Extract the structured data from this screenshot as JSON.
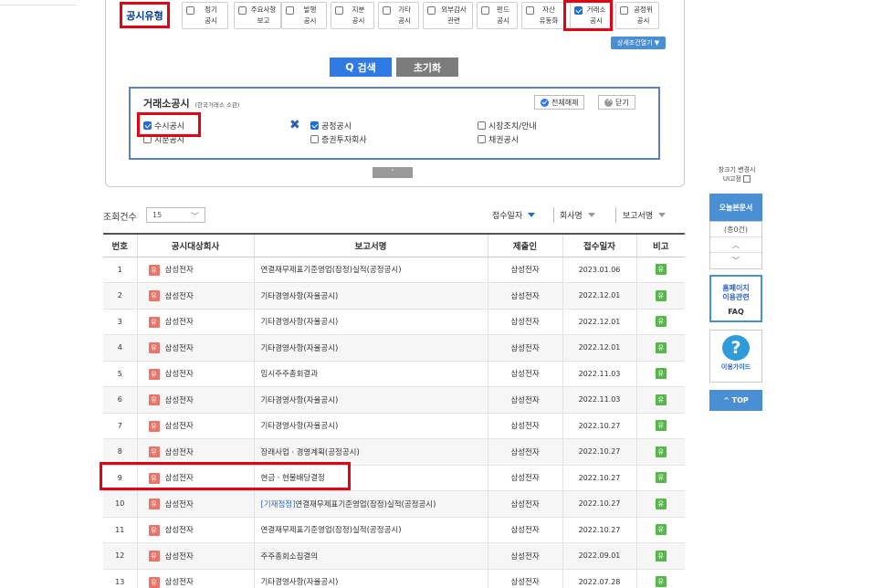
{
  "filter": {
    "type_label": "공시유형",
    "types": [
      {
        "l1": "정기",
        "l2": "공시",
        "checked": false
      },
      {
        "l1": "주요사항",
        "l2": "보고",
        "checked": false
      },
      {
        "l1": "발행",
        "l2": "공시",
        "checked": false
      },
      {
        "l1": "지분",
        "l2": "공시",
        "checked": false
      },
      {
        "l1": "기타",
        "l2": "공시",
        "checked": false
      },
      {
        "l1": "외부감사",
        "l2": "관련",
        "checked": false
      },
      {
        "l1": "펀드",
        "l2": "공시",
        "checked": false
      },
      {
        "l1": "자산",
        "l2": "유동화",
        "checked": false
      },
      {
        "l1": "거래소",
        "l2": "공시",
        "checked": true
      },
      {
        "l1": "공정위",
        "l2": "공시",
        "checked": false
      }
    ],
    "detail_toggle": "상세조건열기 ▼",
    "search_label": "검색",
    "reset_label": "초기화"
  },
  "exchange_panel": {
    "title": "거래소공시",
    "subtitle": "(한국거래소 소관)",
    "select_all_label": "전체해제",
    "close_label": "닫기",
    "options": [
      {
        "label": "수시공시",
        "checked": true
      },
      {
        "label": "지분공시",
        "checked": false
      },
      {
        "label": "공정공시",
        "checked": true
      },
      {
        "label": "증권투자회사",
        "checked": false
      },
      {
        "label": "시장조치/안내",
        "checked": false
      },
      {
        "label": "채권공시",
        "checked": false
      }
    ],
    "collapse_icon": "˄"
  },
  "results": {
    "count_label": "조회건수",
    "page_size": "15",
    "sort": {
      "date": "접수일자",
      "company": "회사명",
      "report": "보고서명"
    },
    "columns": [
      "번호",
      "공시대상회사",
      "보고서명",
      "제출인",
      "접수일자",
      "비고"
    ],
    "rows": [
      {
        "no": "1",
        "badge": "유",
        "company": "삼성전자",
        "prefix": "",
        "report": "연결재무제표기준영업(잠정)실적(공정공시)",
        "filer": "삼성전자",
        "date": "2023.01.06",
        "note": "유"
      },
      {
        "no": "2",
        "badge": "유",
        "company": "삼성전자",
        "prefix": "",
        "report": "기타경영사항(자율공시)",
        "filer": "삼성전자",
        "date": "2022.12.01",
        "note": "유"
      },
      {
        "no": "3",
        "badge": "유",
        "company": "삼성전자",
        "prefix": "",
        "report": "기타경영사항(자율공시)",
        "filer": "삼성전자",
        "date": "2022.12.01",
        "note": "유"
      },
      {
        "no": "4",
        "badge": "유",
        "company": "삼성전자",
        "prefix": "",
        "report": "기타경영사항(자율공시)",
        "filer": "삼성전자",
        "date": "2022.12.01",
        "note": "유"
      },
      {
        "no": "5",
        "badge": "유",
        "company": "삼성전자",
        "prefix": "",
        "report": "임시주주총회결과",
        "filer": "삼성전자",
        "date": "2022.11.03",
        "note": "유"
      },
      {
        "no": "6",
        "badge": "유",
        "company": "삼성전자",
        "prefix": "",
        "report": "기타경영사항(자율공시)",
        "filer": "삼성전자",
        "date": "2022.11.03",
        "note": "유"
      },
      {
        "no": "7",
        "badge": "유",
        "company": "삼성전자",
        "prefix": "",
        "report": "기타경영사항(자율공시)",
        "filer": "삼성전자",
        "date": "2022.10.27",
        "note": "유"
      },
      {
        "no": "8",
        "badge": "유",
        "company": "삼성전자",
        "prefix": "",
        "report": "장래사업ㆍ경영계획(공정공시)",
        "filer": "삼성전자",
        "date": "2022.10.27",
        "note": "유"
      },
      {
        "no": "9",
        "badge": "유",
        "company": "삼성전자",
        "prefix": "",
        "report": "현금ㆍ현물배당결정",
        "filer": "삼성전자",
        "date": "2022.10.27",
        "note": "유"
      },
      {
        "no": "10",
        "badge": "유",
        "company": "삼성전자",
        "prefix": "[기재정정]",
        "report": "연결재무제표기준영업(잠정)실적(공정공시)",
        "filer": "삼성전자",
        "date": "2022.10.27",
        "note": "유"
      },
      {
        "no": "11",
        "badge": "유",
        "company": "삼성전자",
        "prefix": "",
        "report": "연결재무제표기준영업(잠정)실적(공정공시)",
        "filer": "삼성전자",
        "date": "2022.10.27",
        "note": "유"
      },
      {
        "no": "12",
        "badge": "유",
        "company": "삼성전자",
        "prefix": "",
        "report": "주주총회소집결의",
        "filer": "삼성전자",
        "date": "2022.09.01",
        "note": "유"
      },
      {
        "no": "13",
        "badge": "유",
        "company": "삼성전자",
        "prefix": "",
        "report": "기타경영사항(자율공시)",
        "filer": "삼성전자",
        "date": "2022.07.28",
        "note": "유"
      }
    ]
  },
  "sidebar": {
    "window_note_l1": "창크기 변경시",
    "window_note_l2": "UI고정",
    "today_label": "오늘본문서",
    "count": "(총0건)",
    "up": "︿",
    "down": "﹀",
    "home_l1": "홈페이지",
    "home_l2": "이용관련",
    "faq": "FAQ",
    "guide_icon": "?",
    "guide_label": "이용가이드",
    "top_label": "^ TOP"
  },
  "colors": {
    "accent": "#2f7ae5",
    "highlight": "#e60012",
    "badge_red": "#e9756a",
    "badge_green": "#57b84a"
  }
}
